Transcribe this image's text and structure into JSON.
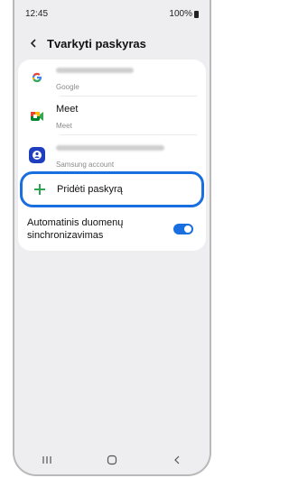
{
  "status": {
    "time": "12:45",
    "battery": "100%"
  },
  "header": {
    "title": "Tvarkyti paskyras"
  },
  "accounts": [
    {
      "service": "Google",
      "icon": "google-icon"
    },
    {
      "name": "Meet",
      "service": "Meet",
      "icon": "meet-icon"
    },
    {
      "service": "Samsung account",
      "icon": "samsung-account-icon"
    }
  ],
  "add_account": {
    "label": "Pridėti paskyrą"
  },
  "sync": {
    "label": "Automatinis duomenų sinchronizavimas",
    "enabled": true
  },
  "colors": {
    "accent": "#1a6fe0",
    "plus": "#2ea44f"
  },
  "navbar": {
    "icons": [
      "recents-icon",
      "home-icon",
      "back-icon"
    ]
  }
}
